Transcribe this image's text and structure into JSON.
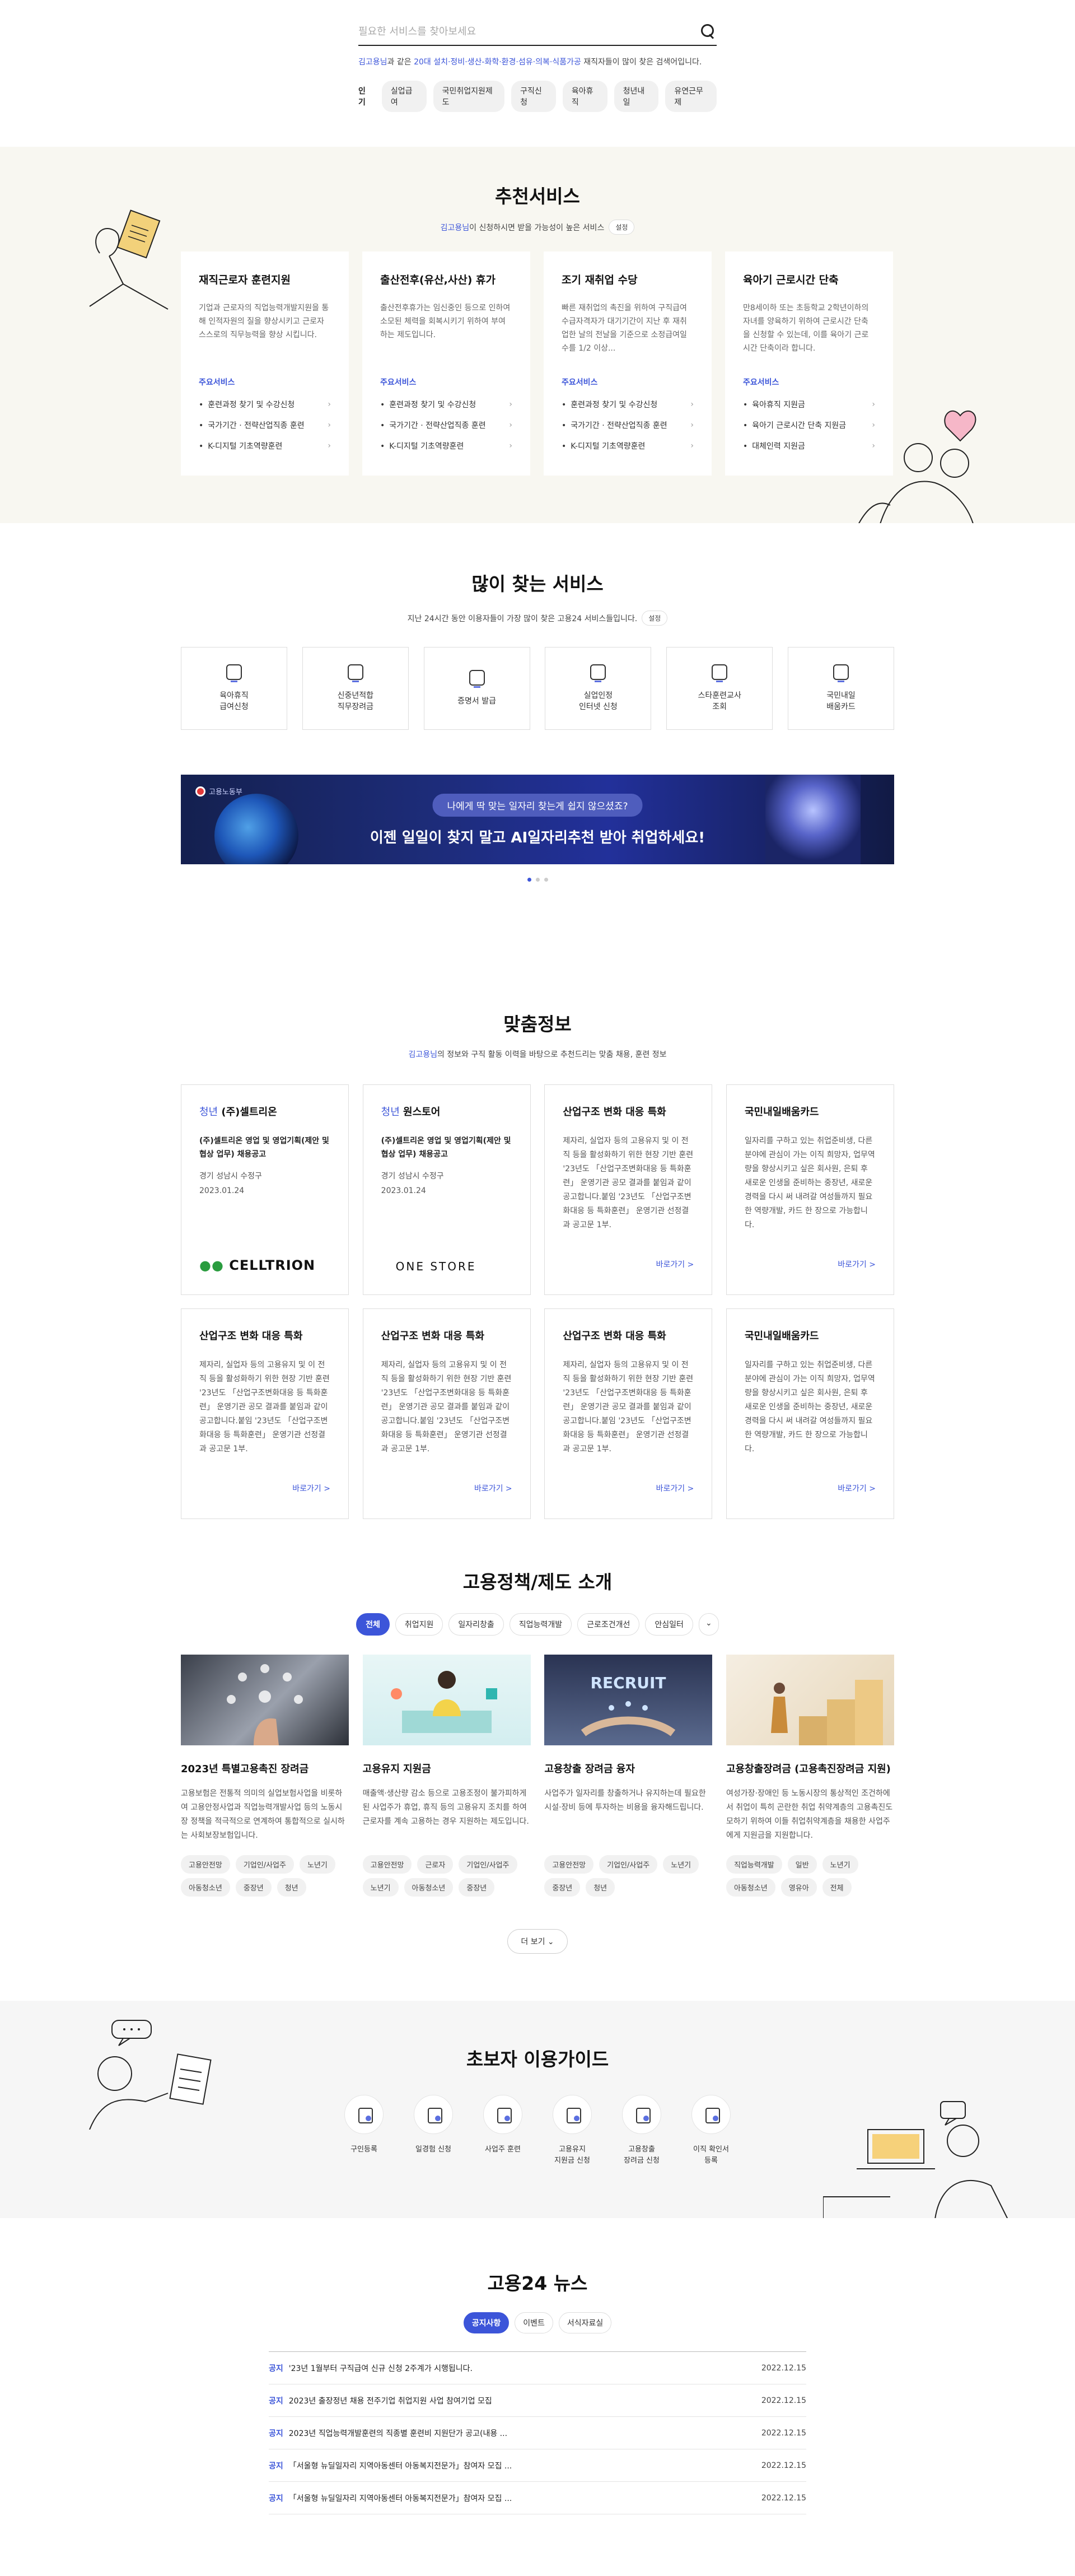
{
  "search": {
    "placeholder": "필요한 서비스를 찾아보세요",
    "rec_user": "김고용님",
    "rec_mid": "과 같은 ",
    "rec_group": "20대 설치·정비·생산-화학·환경·섬유·의복·식품가공",
    "rec_tail": " 재직자들이 많이 찾은 검색어입니다.",
    "popular_label": "인기",
    "popular": [
      "실업급여",
      "국민취업지원제도",
      "구직신청",
      "육아휴직",
      "청년내일",
      "유연근무제"
    ]
  },
  "recommend": {
    "title": "추천서비스",
    "sub_user": "김고용님",
    "sub_text": "이 신청하시면 받을 가능성이 높은 서비스",
    "setting": "설정",
    "cards": [
      {
        "title": "재직근로자 훈련지원",
        "desc": "기업과 근로자의 직업능력개발지원을 통해 인적자원의 질을 향상시키고 근로자 스스로의 직무능력을 향상 시킵니다.",
        "major": "주요서비스",
        "items": [
          "훈련과정 찾기 및 수강신청",
          "국가기간 · 전략산업직종 훈련",
          "K-디지털 기초역량훈련"
        ]
      },
      {
        "title": "출산전후(유산,사산) 휴가",
        "desc": "출산전후휴가는 임신중인 등으로 인하여 소모된 체력을 회복시키기 위하여 부여하는 제도입니다.",
        "major": "주요서비스",
        "items": [
          "훈련과정 찾기 및 수강신청",
          "국가기간 · 전략산업직종 훈련",
          "K-디지털 기초역량훈련"
        ]
      },
      {
        "title": "조기 재취업 수당",
        "desc": "빠른 재취업의 촉진을 위하여 구직급여 수급자격자가 대기기간이 지난 후 재취업한 날의 전날을 기준으로 소정급여일수를 1/2 이상...",
        "major": "주요서비스",
        "items": [
          "훈련과정 찾기 및 수강신청",
          "국가기간 · 전략산업직종 훈련",
          "K-디지털 기초역량훈련"
        ]
      },
      {
        "title": "육아기 근로시간 단축",
        "desc": "만8세이하 또는 초등학교 2학년이하의 자녀를 양육하기 위하여 근로시간 단축을 신청할 수 있는데, 이를 육아기 근로시간 단축이라 합니다.",
        "major": "주요서비스",
        "items": [
          "육아휴직 지원금",
          "육아기 근로시간 단축 지원금",
          "대체인력 지원금"
        ]
      }
    ]
  },
  "frequent": {
    "title": "많이 찾는 서비스",
    "sub": "지난 24시간 동안 이용자들이 가장 많이 찾은 고용24 서비스들입니다.",
    "setting": "설정",
    "items": [
      {
        "label": "육아휴직\n급여신청",
        "icon": "baby-icon"
      },
      {
        "label": "신중년적합\n직무장려금",
        "icon": "coins-icon"
      },
      {
        "label": "증명서 발급",
        "icon": "printer-icon"
      },
      {
        "label": "실업인정\n인터넷 신청",
        "icon": "monitor-icon"
      },
      {
        "label": "스타훈련교사\n조회",
        "icon": "teacher-icon"
      },
      {
        "label": "국민내일\n배움카드",
        "icon": "card-icon"
      }
    ]
  },
  "banner": {
    "logo": "고용노동부",
    "pill": "나에게 딱 맞는 일자리 찾는게 쉽지 않으셨죠?",
    "headline": "이젠 일일이 찾지 말고 AI일자리추천 받아 취업하세요!"
  },
  "custom": {
    "title": "맞춤정보",
    "sub_user": "김고용님",
    "sub_text": "의 정보와 구직 활동 이력을 바탕으로 추천드리는 맞춤 채용, 훈련 정보",
    "more": "바로가기 >",
    "job_cards": [
      {
        "tag": "청년",
        "company": " (주)셀트리온",
        "job": "(주)셀트리온 영업 및 영업기획(제안 및 협상 업무) 채용공고",
        "loc": "경기 성남시 수정구",
        "date": "2023.01.24",
        "logo": "CELLTRION"
      },
      {
        "tag": "청년",
        "company": " 원스토어",
        "job": "(주)셀트리온 영업 및 영업기획(제안 및 협상 업무) 채용공고",
        "loc": "경기 성남시 수정구",
        "date": "2023.01.24",
        "logo": "ONE STORE"
      }
    ],
    "info_cards": [
      {
        "title": "산업구조 변화 대응 특화",
        "body": "제자리, 실업자 등의 고용유지 및 이 전직 등을 활성화하기 위한 현장 기반 훈련 '23년도 「산업구조변화대응 등 특화훈련」 운영기관 공모 결과를 붙임과 같이 공고합니다.붙임 '23년도 「산업구조변화대응 등 특화훈련」 운영기관 선정결과 공고문 1부."
      },
      {
        "title": "국민내일배움카드",
        "body": "일자리를 구하고 있는 취업준비생, 다른 분야에 관심이 가는 이직 희망자, 업무역량을 향상시키고 싶은 회사원, 은퇴 후 새로운 인생을 준비하는 중장년, 새로운 경력을 다시 써 내려갈 여성들까지 필요한 역량개발, 카드 한 장으로 가능합니다."
      },
      {
        "title": "산업구조 변화 대응 특화",
        "body": "제자리, 실업자 등의 고용유지 및 이 전직 등을 활성화하기 위한 현장 기반 훈련 '23년도 「산업구조변화대응 등 특화훈련」 운영기관 공모 결과를 붙임과 같이 공고합니다.붙임 '23년도 「산업구조변화대응 등 특화훈련」 운영기관 선정결과 공고문 1부."
      },
      {
        "title": "산업구조 변화 대응 특화",
        "body": "제자리, 실업자 등의 고용유지 및 이 전직 등을 활성화하기 위한 현장 기반 훈련 '23년도 「산업구조변화대응 등 특화훈련」 운영기관 공모 결과를 붙임과 같이 공고합니다.붙임 '23년도 「산업구조변화대응 등 특화훈련」 운영기관 선정결과 공고문 1부."
      },
      {
        "title": "산업구조 변화 대응 특화",
        "body": "제자리, 실업자 등의 고용유지 및 이 전직 등을 활성화하기 위한 현장 기반 훈련 '23년도 「산업구조변화대응 등 특화훈련」 운영기관 공모 결과를 붙임과 같이 공고합니다.붙임 '23년도 「산업구조변화대응 등 특화훈련」 운영기관 선정결과 공고문 1부."
      },
      {
        "title": "국민내일배움카드",
        "body": "일자리를 구하고 있는 취업준비생, 다른 분야에 관심이 가는 이직 희망자, 업무역량을 향상시키고 싶은 회사원, 은퇴 후 새로운 인생을 준비하는 중장년, 새로운 경력을 다시 써 내려갈 여성들까지 필요한 역량개발, 카드 한 장으로 가능합니다."
      }
    ]
  },
  "policy": {
    "title": "고용정책/제도 소개",
    "tabs": [
      "전체",
      "취업지원",
      "일자리창출",
      "직업능력개발",
      "근로조건개선",
      "안심일터"
    ],
    "more": "더 보기",
    "cards": [
      {
        "title": "2023년 특별고용촉진 장려금",
        "desc": "고용보험은 전통적 의미의 실업보험사업을 비롯하여 고용안정사업과 직업능력개발사업 등의 노동시장 정책을 적극적으로 연계하여 통합적으로 실시하는 사회보장보험입니다.",
        "tags": [
          "고용안전망",
          "기업인/사업주",
          "노년기",
          "아동청소년",
          "중장년",
          "청년"
        ]
      },
      {
        "title": "고용유지 지원금",
        "desc": "매출액·생산량 감소 등으로 고용조정이 불가피하게 된 사업주가 휴업, 휴직 등의 고용유지 조치를 하여 근로자를 계속 고용하는 경우 지원하는 제도입니다.",
        "tags": [
          "고용안전망",
          "근로자",
          "기업인/사업주",
          "노년기",
          "아동청소년",
          "중장년"
        ]
      },
      {
        "title": "고용창출 장려금 융자",
        "desc": "사업주가 일자리를 창출하거나 유지하는데 필요한 시설·장비 등에 투자하는 비용을 융자해드립니다.",
        "tags": [
          "고용안전망",
          "기업인/사업주",
          "노년기",
          "중장년",
          "청년"
        ]
      },
      {
        "title": "고용창출장려금 (고용촉진장려금 지원)",
        "desc": "여성가장·장애인 등 노동시장의 통상적인 조건하에서 취업이 특히 곤란한 취업 취약계층의 고용촉진도모하기 위하여 이들 취업취약계층을 채용한 사업주에게 지원금을 지원합니다.",
        "tags": [
          "직업능력개발",
          "일반",
          "노년기",
          "아동청소년",
          "영유아",
          "전체"
        ]
      }
    ]
  },
  "guide": {
    "title": "초보자 이용가이드",
    "items": [
      {
        "label": "구인등록",
        "icon": "register-icon"
      },
      {
        "label": "일경험 신청",
        "icon": "calendar-icon"
      },
      {
        "label": "사업주 훈련",
        "icon": "grid-icon"
      },
      {
        "label": "고용유지\n지원금 신청",
        "icon": "document-icon"
      },
      {
        "label": "고용창출\n장려금 신청",
        "icon": "briefcase-icon"
      },
      {
        "label": "이직 확인서\n등록",
        "icon": "id-card-icon"
      }
    ]
  },
  "news": {
    "title": "고용24 뉴스",
    "tabs": [
      "공지사항",
      "이벤트",
      "서식자료실"
    ],
    "rows": [
      {
        "cat": "공지",
        "title": "'23년 1월부터 구직급여 신규 신청 2주계가 시행됩니다.",
        "date": "2022.12.15"
      },
      {
        "cat": "공지",
        "title": "2023년 출장정년 채용 전주기업 취업지원 사업 참여기업 모집",
        "date": "2022.12.15"
      },
      {
        "cat": "공지",
        "title": "2023년 직업능력개발훈련의 직종별 훈련비 지원단가 공고(내용 ...",
        "date": "2022.12.15"
      },
      {
        "cat": "공지",
        "title": "「서울형 뉴딜일자리 지역아동센터 아동복지전문가」참여자 모집 ...",
        "date": "2022.12.15"
      },
      {
        "cat": "공지",
        "title": "「서울형 뉴딜일자리 지역아동센터 아동복지전문가」참여자 모집 ...",
        "date": "2022.12.15"
      }
    ]
  }
}
